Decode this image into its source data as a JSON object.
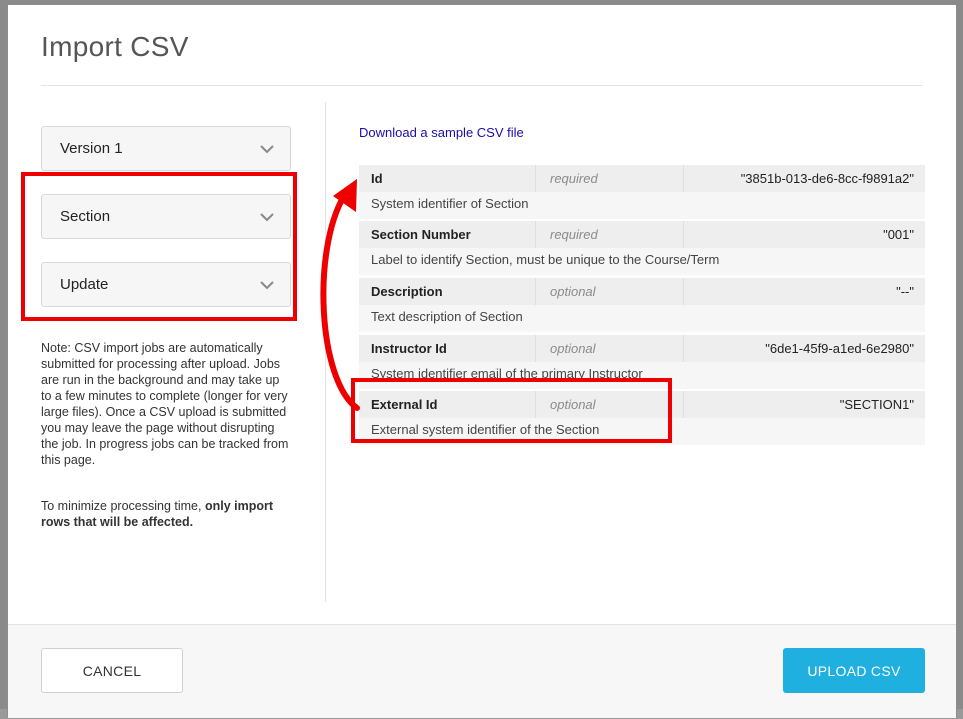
{
  "modal": {
    "title": "Import CSV"
  },
  "dropdowns": {
    "version": "Version 1",
    "object": "Section",
    "action": "Update"
  },
  "note": {
    "text": "Note: CSV import jobs are automatically submitted for processing after upload. Jobs are run in the background and may take up to a few minutes to complete (longer for very large files). Once a CSV upload is submitted you may leave the page without disrupting the job. In progress jobs can be tracked from this page.",
    "tip_prefix": "To minimize processing time, ",
    "tip_bold": "only import rows that will be affected."
  },
  "sample_link": "Download a sample CSV file",
  "fields": [
    {
      "name": "Id",
      "requirement": "required",
      "value": "\"3851b-013-de6-8cc-f9891a2\"",
      "description": "System identifier of Section"
    },
    {
      "name": "Section Number",
      "requirement": "required",
      "value": "\"001\"",
      "description": "Label to identify Section, must be unique to the Course/Term"
    },
    {
      "name": "Description",
      "requirement": "optional",
      "value": "\"--\"",
      "description": "Text description of Section"
    },
    {
      "name": "Instructor Id",
      "requirement": "optional",
      "value": "\"6de1-45f9-a1ed-6e2980\"",
      "description": "System identifier email of the primary Instructor"
    },
    {
      "name": "External Id",
      "requirement": "optional",
      "value": "\"SECTION1\"",
      "description": "External system identifier of the Section"
    }
  ],
  "footer": {
    "cancel_label": "CANCEL",
    "upload_label": "UPLOAD CSV"
  },
  "colors": {
    "accent": "#1fb0df",
    "highlight": "#ee0000"
  }
}
